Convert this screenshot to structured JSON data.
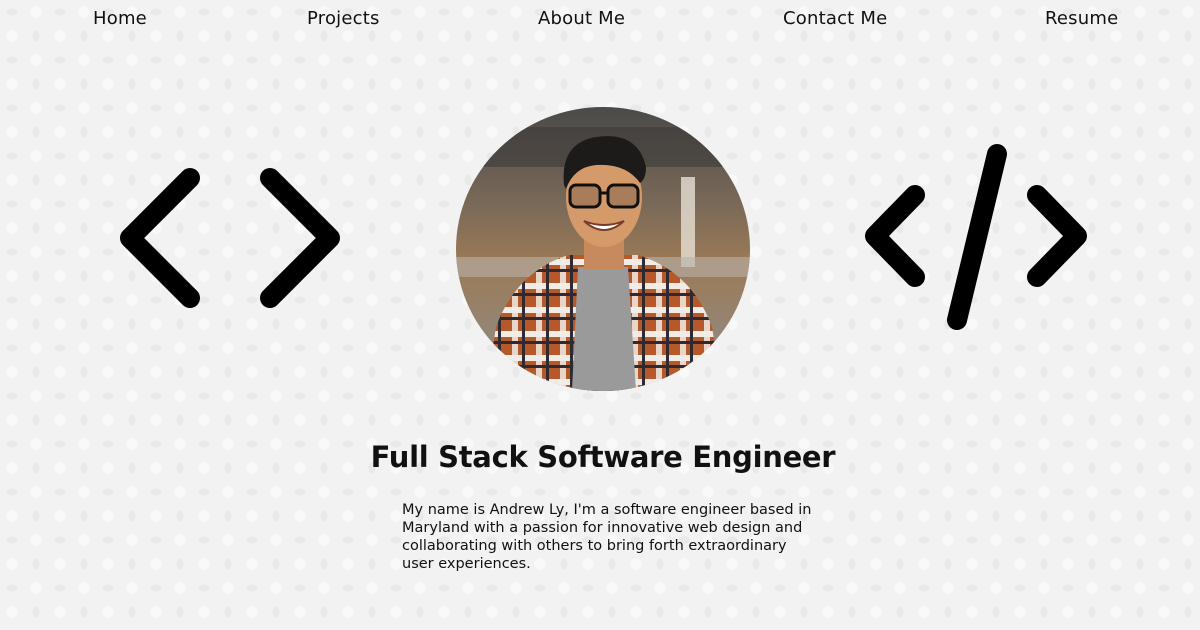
{
  "nav": {
    "items": [
      {
        "label": "Home"
      },
      {
        "label": "Projects"
      },
      {
        "label": "About Me"
      },
      {
        "label": "Contact Me"
      },
      {
        "label": "Resume"
      }
    ]
  },
  "icons": {
    "left": "angle-brackets-icon",
    "right": "code-slash-icon"
  },
  "profile": {
    "avatar_icon": "profile-photo"
  },
  "hero": {
    "headline": "Full Stack Software Engineer",
    "bio": "My name is Andrew Ly, I'm a software engineer based in Maryland with a passion for innovative web design and collaborating with others to bring forth extraordinary user experiences."
  },
  "colors": {
    "background": "#f2f2f2",
    "text": "#111111"
  }
}
